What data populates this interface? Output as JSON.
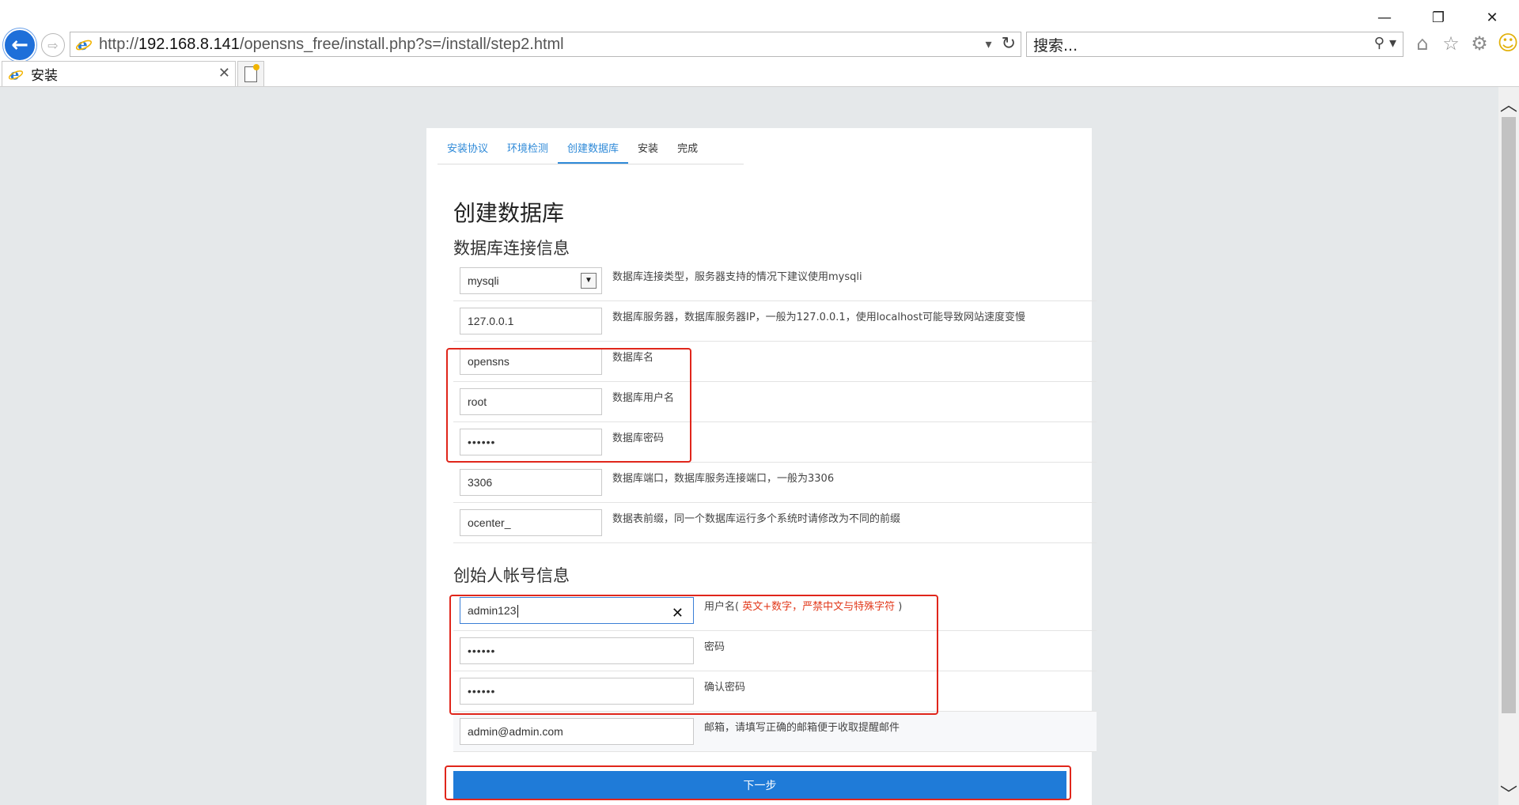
{
  "browser": {
    "url_prefix": "http://",
    "url_host": "192.168.8.141",
    "url_path": "/opensns_free/install.php?s=/install/step2.html",
    "search_placeholder": "搜索...",
    "tab_title": "安装",
    "window_controls": {
      "minimize": "—",
      "restore": "❐",
      "close": "✕"
    },
    "icons": [
      "back-arrow-icon",
      "forward-arrow-icon",
      "ie-icon",
      "refresh-icon",
      "search-icon",
      "home-icon",
      "favorites-star-icon",
      "settings-gear-icon",
      "smiley-feedback-icon"
    ]
  },
  "steps": [
    {
      "label": "安装协议",
      "state": "done"
    },
    {
      "label": "环境检测",
      "state": "done"
    },
    {
      "label": "创建数据库",
      "state": "active"
    },
    {
      "label": "安装",
      "state": "todo"
    },
    {
      "label": "完成",
      "state": "todo"
    }
  ],
  "page_title": "创建数据库",
  "db_section": {
    "title": "数据库连接信息",
    "fields": [
      {
        "value": "mysqli",
        "desc": "数据库连接类型，服务器支持的情况下建议使用mysqli"
      },
      {
        "value": "127.0.0.1",
        "desc": "数据库服务器，数据库服务器IP，一般为127.0.0.1，使用localhost可能导致网站速度变慢"
      },
      {
        "value": "opensns",
        "desc": "数据库名"
      },
      {
        "value": "root",
        "desc": "数据库用户名"
      },
      {
        "value": "••••••",
        "desc": "数据库密码"
      },
      {
        "value": "3306",
        "desc": "数据库端口，数据库服务连接端口，一般为3306"
      },
      {
        "value": "ocenter_",
        "desc": "数据表前缀，同一个数据库运行多个系统时请修改为不同的前缀"
      }
    ]
  },
  "admin_section": {
    "title": "创始人帐号信息",
    "fields": [
      {
        "value": "admin123",
        "desc_prefix": "用户名(",
        "desc_warn": " 英文+数字，严禁中文与特殊字符",
        "desc_suffix": " )"
      },
      {
        "value": "••••••",
        "desc": "密码"
      },
      {
        "value": "••••••",
        "desc": "确认密码"
      },
      {
        "value": "admin@admin.com",
        "desc": "邮箱，请填写正确的邮箱便于收取提醒邮件"
      }
    ]
  },
  "next_button": "下一步",
  "colors": {
    "accent": "#1f7bd8",
    "step_link": "#2f8ad8",
    "warning": "#e23a1c",
    "annotation": "#e0261b"
  }
}
